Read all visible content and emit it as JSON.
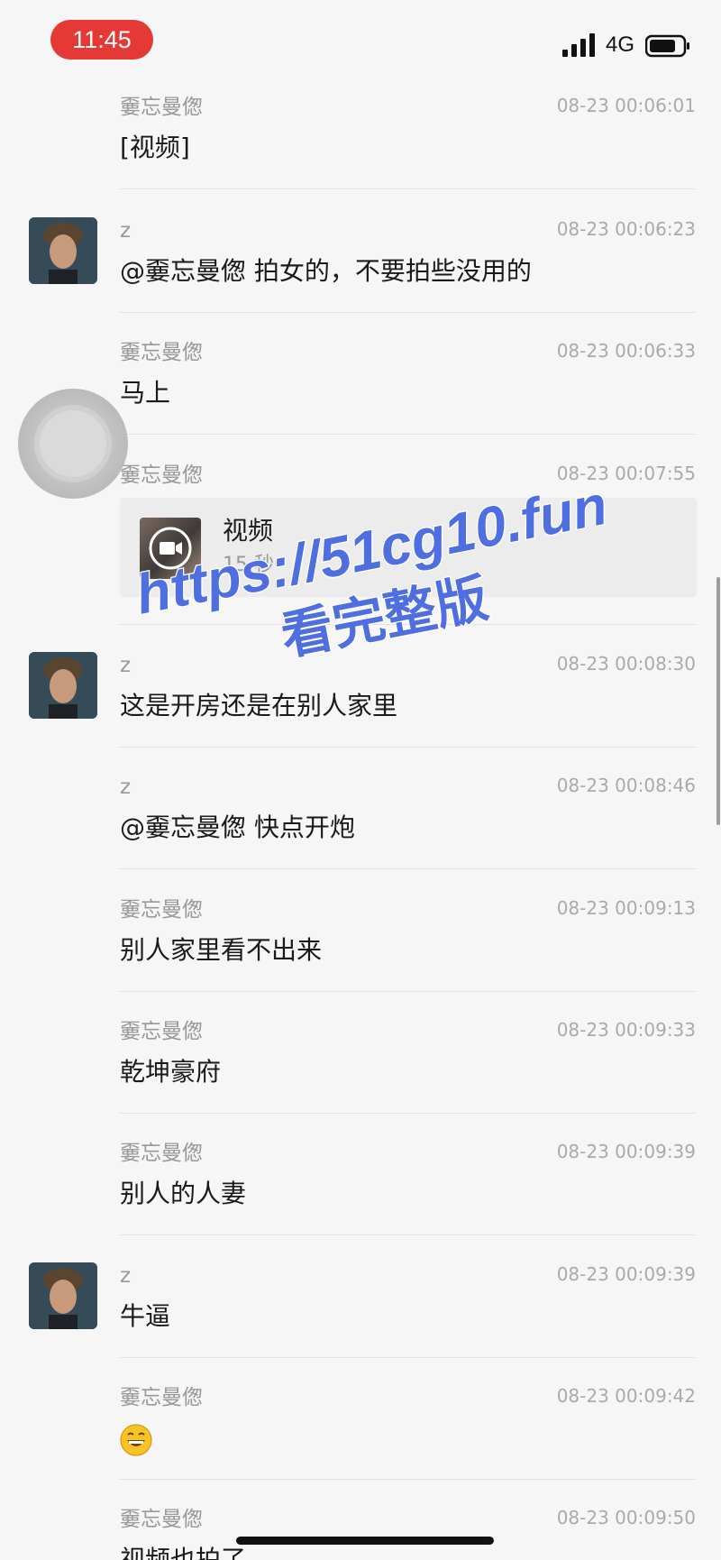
{
  "status_bar": {
    "time": "11:45",
    "network": "4G",
    "icons": [
      "signal-icon",
      "battery-icon"
    ]
  },
  "messages": [
    {
      "sender": "嫑忘曼偬",
      "timestamp": "08-23 00:06:01",
      "text": "[视频]",
      "has_avatar": false
    },
    {
      "sender": "z",
      "timestamp": "08-23 00:06:23",
      "text": "@嫑忘曼偬 拍女的，不要拍些没用的",
      "has_avatar": true
    },
    {
      "sender": "嫑忘曼偬",
      "timestamp": "08-23 00:06:33",
      "text": "马上",
      "has_avatar": false
    },
    {
      "sender": "嫑忘曼偬",
      "timestamp": "08-23 00:07:55",
      "video_card": {
        "title": "视频",
        "duration": "15 秒"
      },
      "has_avatar": false
    },
    {
      "sender": "z",
      "timestamp": "08-23 00:08:30",
      "text": "这是开房还是在别人家里",
      "has_avatar": true
    },
    {
      "sender": "z",
      "timestamp": "08-23 00:08:46",
      "text": "@嫑忘曼偬 快点开炮",
      "has_avatar": false
    },
    {
      "sender": "嫑忘曼偬",
      "timestamp": "08-23 00:09:13",
      "text": "别人家里看不出来",
      "has_avatar": false
    },
    {
      "sender": "嫑忘曼偬",
      "timestamp": "08-23 00:09:33",
      "text": "乾坤豪府",
      "has_avatar": false
    },
    {
      "sender": "嫑忘曼偬",
      "timestamp": "08-23 00:09:39",
      "text": "别人的人妻",
      "has_avatar": false
    },
    {
      "sender": "z",
      "timestamp": "08-23 00:09:39",
      "text": "牛逼",
      "has_avatar": true
    },
    {
      "sender": "嫑忘曼偬",
      "timestamp": "08-23 00:09:42",
      "emoji": "grinning-face-icon",
      "has_avatar": false
    },
    {
      "sender": "嫑忘曼偬",
      "timestamp": "08-23 00:09:50",
      "text": "视频也拍了",
      "has_avatar": false
    }
  ],
  "watermark": {
    "line1": "https://51cg10.fun",
    "line2": "看完整版",
    "color": "#4f6fe0"
  },
  "colors": {
    "background": "#f6f6f6",
    "time_pill": "#e53935",
    "meta_text": "#999999"
  }
}
